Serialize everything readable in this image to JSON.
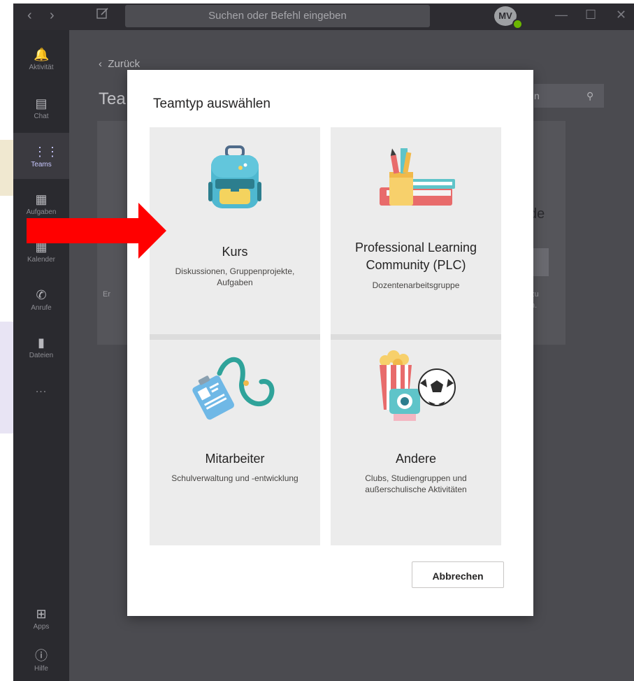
{
  "window": {
    "search_placeholder": "Suchen oder Befehl eingeben",
    "avatar_initials": "MV"
  },
  "rail": {
    "items": [
      {
        "label": "Aktivität",
        "icon": "bell-icon"
      },
      {
        "label": "Chat",
        "icon": "chat-icon"
      },
      {
        "label": "Teams",
        "icon": "teams-icon"
      },
      {
        "label": "Aufgaben",
        "icon": "backpack-icon"
      },
      {
        "label": "Kalender",
        "icon": "calendar-icon"
      },
      {
        "label": "Anrufe",
        "icon": "phone-icon"
      },
      {
        "label": "Dateien",
        "icon": "file-icon"
      }
    ],
    "more": "...",
    "apps_label": "Apps",
    "help_label": "Hilfe"
  },
  "background": {
    "back_label": "Zurück",
    "title_partial": "Tea",
    "search_partial": "n",
    "card_text_partial": "de",
    "left_fragment": "Er",
    "right_fragment_1": "zu",
    "right_fragment_2": "n."
  },
  "dialog": {
    "title": "Teamtyp auswählen",
    "tiles": [
      {
        "title": "Kurs",
        "description": "Diskussionen, Gruppenprojekte, Aufgaben",
        "icon": "backpack-illustration"
      },
      {
        "title": "Professional Learning Community (PLC)",
        "description": "Dozentenarbeitsgruppe",
        "icon": "books-pencils-illustration"
      },
      {
        "title": "Mitarbeiter",
        "description": "Schulverwaltung und -entwicklung",
        "icon": "lanyard-badge-illustration"
      },
      {
        "title": "Andere",
        "description": "Clubs, Studiengruppen und außerschulische Aktivitäten",
        "icon": "popcorn-camera-ball-illustration"
      }
    ],
    "cancel_label": "Abbrechen"
  },
  "colors": {
    "overlay_arrow": "#ff0000",
    "brand": "#6264a7",
    "rail_bg": "#2a2a2f",
    "dialog_bg": "#ffffff",
    "tile_bg": "#ececec"
  }
}
